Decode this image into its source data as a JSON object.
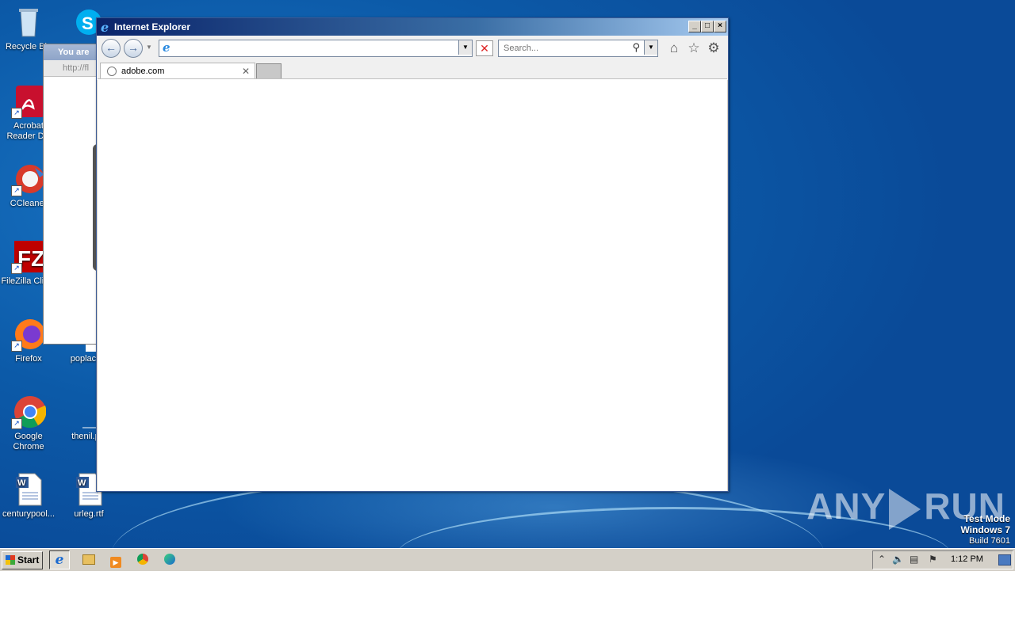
{
  "desktop": {
    "icons": [
      {
        "label": "Recycle Bin"
      },
      {
        "label": "Acrobat Reader DC"
      },
      {
        "label": "CCleaner"
      },
      {
        "label": "FileZilla Client"
      },
      {
        "label": "Firefox"
      },
      {
        "label": "Google Chrome"
      },
      {
        "label": "centurypool..."
      },
      {
        "label": "poplace"
      },
      {
        "label": "thenil.p"
      },
      {
        "label": "urleg.rtf"
      }
    ],
    "watermark": {
      "left": "ANY",
      "right": "RUN"
    },
    "test_mode": {
      "line1": "Test Mode",
      "line2": "Windows 7",
      "line3": "Build 7601"
    }
  },
  "background_window": {
    "title": "You are",
    "address": "http://fl"
  },
  "ie_window": {
    "title": "Internet Explorer",
    "address_value": "",
    "search_placeholder": "Search...",
    "tab": {
      "label": "adobe.com"
    }
  },
  "taskbar": {
    "start_label": "Start",
    "clock": "1:12 PM"
  },
  "colors": {
    "desktop": "#0c5aa8",
    "titlebar": "#0a246a",
    "taskbar": "#d4d0c8"
  }
}
